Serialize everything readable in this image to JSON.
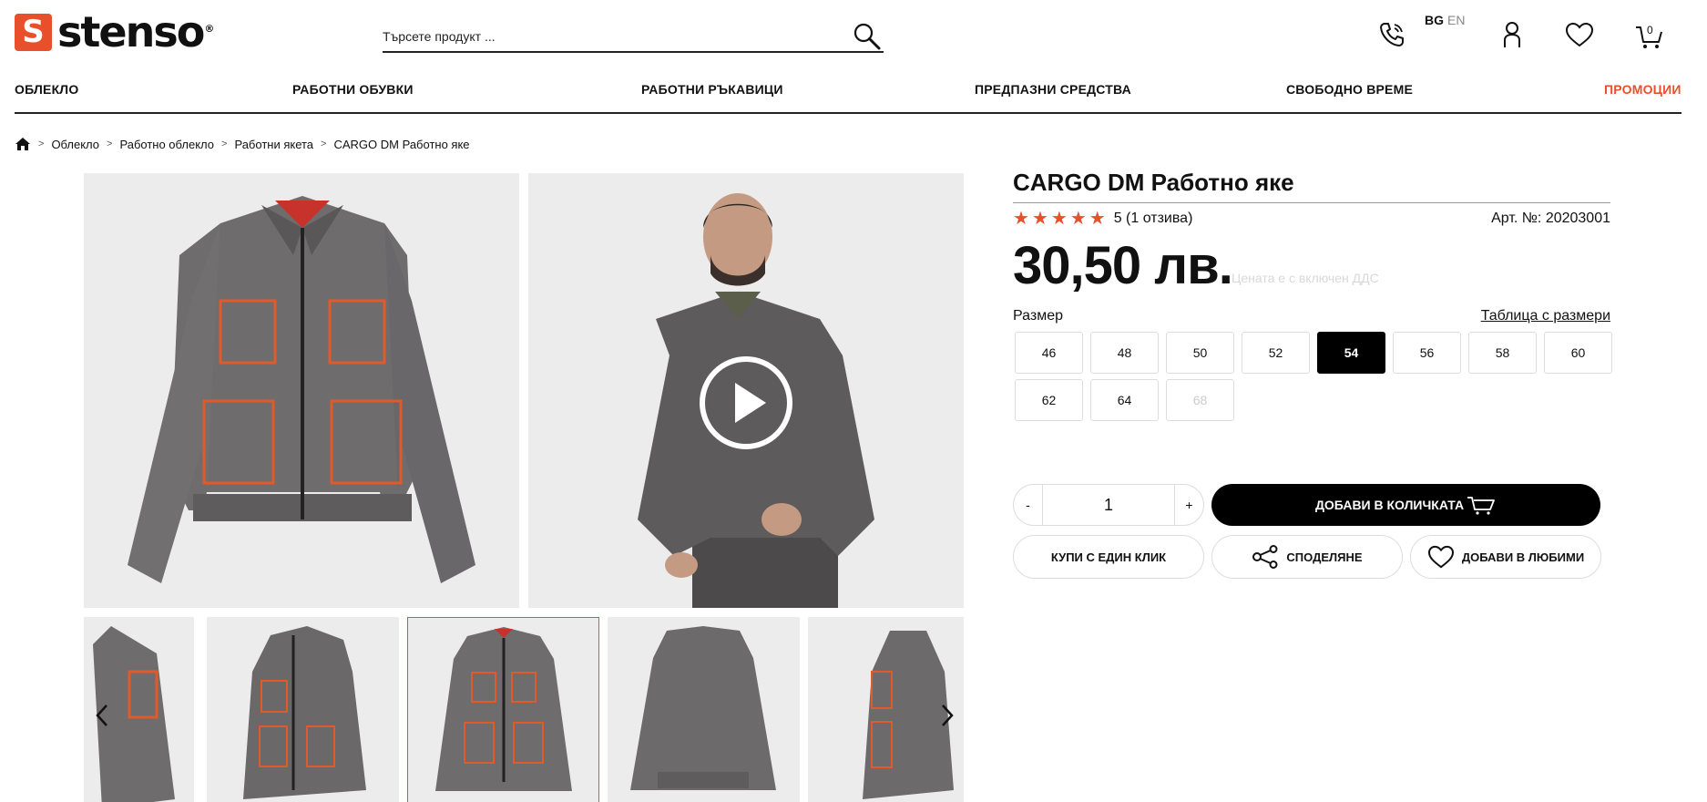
{
  "brand": {
    "name": "stenso",
    "mark": "S",
    "reg": "®",
    "accent": "#e8502b"
  },
  "search": {
    "placeholder": "Търсете продукт ..."
  },
  "header": {
    "lang_active": "BG",
    "lang_other": "EN",
    "cart_count": "0"
  },
  "nav": {
    "items": [
      {
        "label": "ОБЛЕКЛО"
      },
      {
        "label": "РАБОТНИ ОБУВКИ"
      },
      {
        "label": "РАБОТНИ РЪКАВИЦИ"
      },
      {
        "label": "ПРЕДПАЗНИ СРЕДСТВА"
      },
      {
        "label": "СВОБОДНО ВРЕМЕ"
      },
      {
        "label": "ПРОМОЦИИ"
      }
    ]
  },
  "breadcrumb": [
    "Облекло",
    "Работно облекло",
    "Работни якета",
    "CARGO DM Работно яке"
  ],
  "product": {
    "title": "CARGO DM Работно яке",
    "rating": 5,
    "rating_text": "5 (1 отзива)",
    "article": "Арт. №: 20203001",
    "price": "30,50 лв.",
    "vat_note": "Цената е с включен ДДС",
    "size_label": "Размер",
    "size_table_link": "Таблица с размери",
    "sizes": [
      {
        "label": "46"
      },
      {
        "label": "48"
      },
      {
        "label": "50"
      },
      {
        "label": "52"
      },
      {
        "label": "54",
        "selected": true
      },
      {
        "label": "56"
      },
      {
        "label": "58"
      },
      {
        "label": "60"
      },
      {
        "label": "62"
      },
      {
        "label": "64"
      },
      {
        "label": "68",
        "disabled": true
      }
    ],
    "qty_minus": "-",
    "qty_value": "1",
    "qty_plus": "+",
    "add_to_cart": "ДОБАВИ В КОЛИЧКАТА",
    "one_click": "КУПИ С ЕДИН КЛИК",
    "share": "СПОДЕЛЯНЕ",
    "add_favorites": "ДОБАВИ В ЛЮБИМИ"
  }
}
